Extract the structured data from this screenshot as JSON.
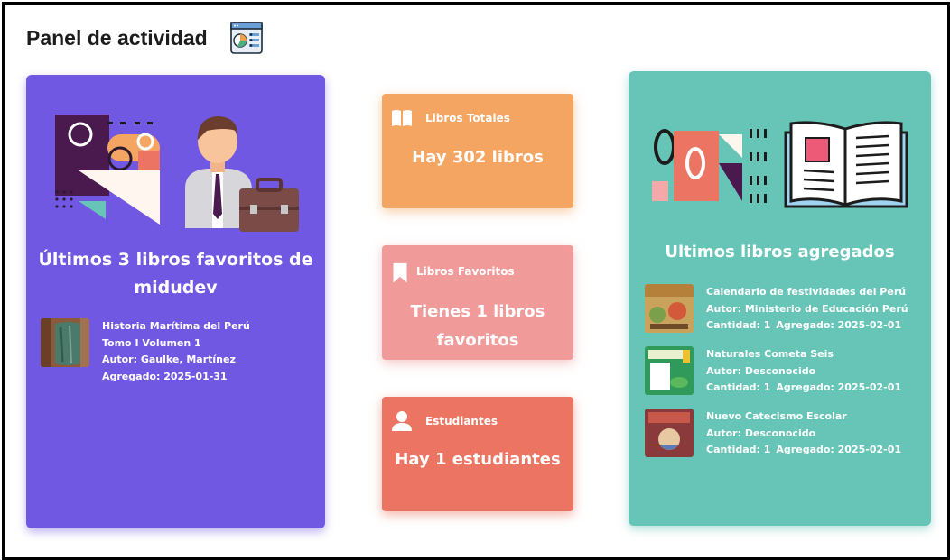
{
  "header": {
    "title": "Panel de actividad",
    "icon": "dashboard-report-icon"
  },
  "favorites": {
    "title": "Últimos 3 libros favoritos de midudev",
    "items": [
      {
        "title": "Historia Marítima del Perú Tomo I Volumen 1",
        "author": "Autor: Gaulke, Martínez",
        "added": "Agregado: 2025-01-31"
      }
    ],
    "color": "#7158e2"
  },
  "stats": {
    "total": {
      "label": "Libros Totales",
      "value": "Hay 302 libros",
      "icon": "book-open-icon",
      "color": "#f4a561"
    },
    "favorites": {
      "label": "Libros Favoritos",
      "value": "Tienes 1 libros favoritos",
      "icon": "bookmark-icon",
      "color": "#f19a9a"
    },
    "students": {
      "label": "Estudiantes",
      "value": "Hay 1 estudiantes",
      "icon": "user-icon",
      "color": "#ec7462"
    }
  },
  "recent": {
    "title": "Ultimos libros agregados",
    "color": "#67c5b8",
    "items": [
      {
        "title": "Calendario de festividades del Perú",
        "author": "Autor: Ministerio de Educación Perú",
        "quantity": "Cantidad: 1",
        "added": "Agregado: 2025-02-01"
      },
      {
        "title": "Naturales Cometa Seis",
        "author": "Autor: Desconocido",
        "quantity": "Cantidad: 1",
        "added": "Agregado: 2025-02-01"
      },
      {
        "title": "Nuevo Catecismo Escolar",
        "author": "Autor: Desconocido",
        "quantity": "Cantidad: 1",
        "added": "Agregado: 2025-02-01"
      }
    ]
  }
}
